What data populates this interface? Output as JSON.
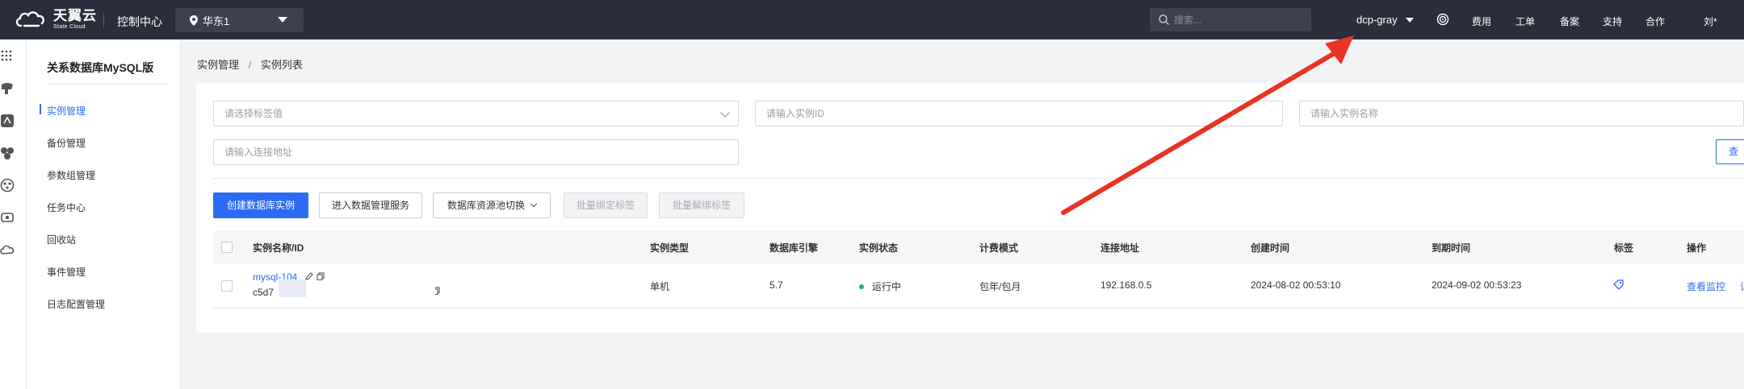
{
  "topbar": {
    "logo_cn": "天翼云",
    "logo_en": "State Cloud",
    "console": "控制中心",
    "region": "华东1",
    "search_placeholder": "搜索...",
    "account": "dcp-gray",
    "links": [
      "费用",
      "工单",
      "备案",
      "支持",
      "合作"
    ],
    "user": "刘*"
  },
  "sidenav": {
    "title": "关系数据库MySQL版",
    "items": [
      {
        "label": "实例管理",
        "active": true
      },
      {
        "label": "备份管理"
      },
      {
        "label": "参数组管理"
      },
      {
        "label": "任务中心"
      },
      {
        "label": "回收站"
      },
      {
        "label": "事件管理"
      },
      {
        "label": "日志配置管理"
      }
    ]
  },
  "breadcrumb": {
    "parent": "实例管理",
    "sep": "/",
    "current": "实例列表"
  },
  "filters": {
    "tag_placeholder": "请选择标签值",
    "id_placeholder": "请输入实例ID",
    "name_placeholder": "请输入实例名称",
    "address_placeholder": "请输入连接地址",
    "query_label": "查"
  },
  "actions": {
    "create": "创建数据库实例",
    "manage": "进入数据管理服务",
    "pool_switch": "数据库资源池切换",
    "batch_bind": "批量绑定标签",
    "batch_unbind": "批量解绑标签"
  },
  "table": {
    "headers": [
      "实例名称/ID",
      "实例类型",
      "数据库引擎",
      "实例状态",
      "计费模式",
      "连接地址",
      "创建时间",
      "到期时间",
      "标签",
      "操作"
    ],
    "rows": [
      {
        "name": "mysql-104",
        "id": "c5d7",
        "type": "单机",
        "engine": "5.7",
        "status": "运行中",
        "billing": "包年/包月",
        "address": "192.168.0.5",
        "created": "2024-08-02 00:53:10",
        "expires": "2024-09-02 00:53:23",
        "action_monitor": "查看监控",
        "action_more": "详"
      }
    ]
  },
  "colors": {
    "topbar": "#2a2d3b",
    "accent": "#2c6bf3",
    "running": "#1bb46b",
    "annotation_arrow": "#ea3323"
  }
}
